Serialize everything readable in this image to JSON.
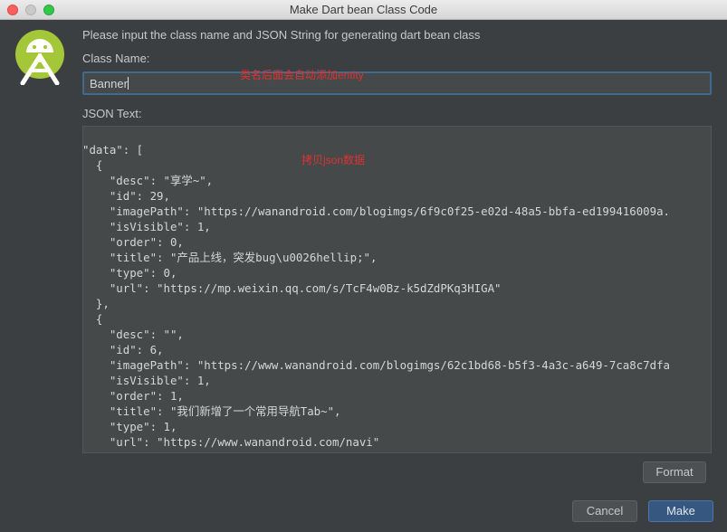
{
  "window": {
    "title": "Make Dart bean Class Code"
  },
  "instruction": "Please input the class name and JSON String for generating dart bean class",
  "class_name": {
    "label": "Class Name:",
    "value": "Banner",
    "annotation": "类名后面会自动添加entity"
  },
  "json_text": {
    "label": "JSON Text:",
    "annotation": "拷贝json数据",
    "lines": [
      "\"data\": [",
      "  {",
      "    \"desc\": \"享学~\",",
      "    \"id\": 29,",
      "    \"imagePath\": \"https://wanandroid.com/blogimgs/6f9c0f25-e02d-48a5-bbfa-ed199416009a.",
      "    \"isVisible\": 1,",
      "    \"order\": 0,",
      "    \"title\": \"产品上线，突发bug\\u0026hellip;\",",
      "    \"type\": 0,",
      "    \"url\": \"https://mp.weixin.qq.com/s/TcF4w0Bz-k5dZdPKq3HIGA\"",
      "  },",
      "  {",
      "    \"desc\": \"\",",
      "    \"id\": 6,",
      "    \"imagePath\": \"https://www.wanandroid.com/blogimgs/62c1bd68-b5f3-4a3c-a649-7ca8c7dfa",
      "    \"isVisible\": 1,",
      "    \"order\": 1,",
      "    \"title\": \"我们新增了一个常用导航Tab~\",",
      "    \"type\": 1,",
      "    \"url\": \"https://www.wanandroid.com/navi\"",
      "  },"
    ]
  },
  "buttons": {
    "format": "Format",
    "cancel": "Cancel",
    "make": "Make"
  },
  "icons": {
    "logo": "android-studio-icon"
  },
  "colors": {
    "accent": "#365880",
    "annotation": "#e03232",
    "android_green": "#a4c639"
  }
}
